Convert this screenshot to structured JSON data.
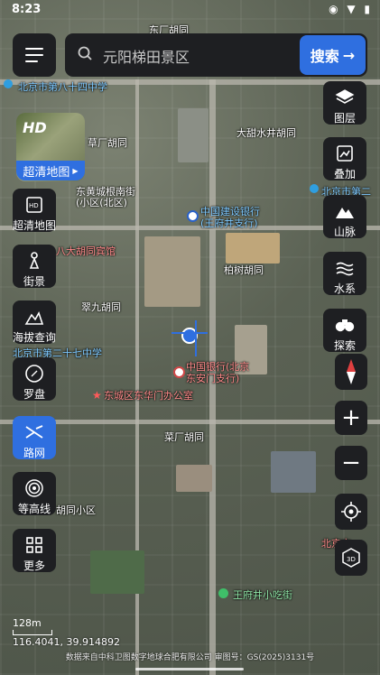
{
  "status_bar": {
    "time": "8:23",
    "icons": "◉ ▼ ▮"
  },
  "search": {
    "placeholder": "元阳梯田景区",
    "button_label": "搜索"
  },
  "hd_map": {
    "badge": "HD",
    "label": "超清地图"
  },
  "left_tools": [
    {
      "name": "hd-map-tool",
      "label": "超清地图",
      "icon": "map-hd-icon"
    },
    {
      "name": "street-view-tool",
      "label": "街景",
      "icon": "street-view-icon"
    },
    {
      "name": "altitude-tool",
      "label": "海拔查询",
      "icon": "altitude-icon"
    },
    {
      "name": "compass-tool",
      "label": "罗盘",
      "icon": "compass-icon"
    },
    {
      "name": "road-network-tool",
      "label": "路网",
      "icon": "road-network-icon"
    },
    {
      "name": "contour-tool",
      "label": "等高线",
      "icon": "contour-icon"
    },
    {
      "name": "more-tool",
      "label": "更多",
      "icon": "more-grid-icon"
    }
  ],
  "right_tools": [
    {
      "name": "layers-tool",
      "label": "图层",
      "icon": "layers-icon"
    },
    {
      "name": "overlay-tool",
      "label": "叠加",
      "icon": "overlay-icon"
    },
    {
      "name": "mountain-tool",
      "label": "山脉",
      "icon": "mountain-icon"
    },
    {
      "name": "water-tool",
      "label": "水系",
      "icon": "water-icon"
    },
    {
      "name": "explore-tool",
      "label": "探索",
      "icon": "binoculars-icon"
    }
  ],
  "map_labels": {
    "top_alley": "东厂胡同",
    "school_84": "北京市第八十四中学",
    "dajiang_alley": "大甜水井胡同",
    "caochang_alley": "草厂胡同",
    "north_school_2": "北京市第二",
    "dongfang_xinjie": "东黄城根南街",
    "north_area": "(小区(北区)",
    "ccb": "中国建设银行",
    "ccb_branch": "(王府井支行)",
    "high_school": "八大胡同宾馆",
    "baishu_alley": "柏树胡同",
    "jiujiu_alley": "翠九胡同",
    "school_27": "北京市第二十七中学",
    "boc": "中国银行(北京",
    "boc_branch": "东安门支行)",
    "dongcheng_office": "东城区东华门办公室",
    "caochang": "菜厂胡同",
    "xiaoqu": "胡同小区",
    "north_park": "北京市",
    "wangfujing_snack": "王府井小吃街"
  },
  "scale": {
    "label": "128m"
  },
  "coordinates": {
    "text": "116.4041, 39.914892"
  },
  "copyright": {
    "text": "数据来自中科卫图数字地球合肥有限公司 审图号：GS(2025)3131号"
  }
}
